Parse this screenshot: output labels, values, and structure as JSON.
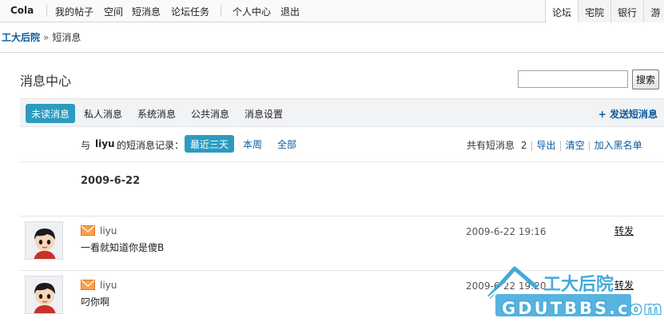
{
  "topnav": {
    "username": "Cola",
    "links": [
      "我的帖子",
      "空间",
      "短消息",
      "论坛任务"
    ],
    "account_links": [
      "个人中心",
      "退出"
    ],
    "right_tabs": [
      "论坛",
      "宅院",
      "银行",
      "游"
    ]
  },
  "breadcrumb": {
    "home": "工大后院",
    "separator": "»",
    "current": "短消息"
  },
  "panel": {
    "title": "消息中心",
    "search": {
      "button_label": "搜索",
      "value": ""
    }
  },
  "tabs": [
    "未读消息",
    "私人消息",
    "系统消息",
    "公共消息",
    "消息设置"
  ],
  "compose_label": "+ 发送短消息",
  "filter": {
    "prefix": "与",
    "user": "liyu",
    "suffix": "的短消息记录：",
    "ranges": [
      "最近三天",
      "本周",
      "全部"
    ],
    "total_label": "共有短消息",
    "total_count": "2",
    "actions": [
      "导出",
      "清空",
      "加入黑名单"
    ]
  },
  "date_heading": "2009-6-22",
  "messages": [
    {
      "sender": "liyu",
      "text": "一看就知道你是傻B",
      "time": "2009-6-22 19:16",
      "action": "转发"
    },
    {
      "sender": "liyu",
      "text": "叼你啊",
      "time": "2009-6-22 19:20",
      "action": "转发"
    }
  ],
  "watermark": {
    "text_cn": "工大后院",
    "text_en": "GDUTBBS.com"
  },
  "colors": {
    "accent": "#2b9bc0",
    "link": "#0a5a9c",
    "envelope": "#e8731e"
  },
  "icons": [
    "envelope-icon",
    "avatar",
    "house-logo-icon"
  ]
}
